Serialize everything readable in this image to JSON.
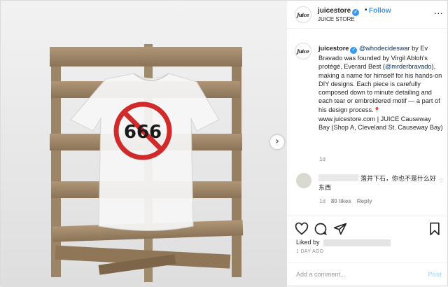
{
  "header": {
    "username": "juicestore",
    "dot": "•",
    "follow_label": "Follow",
    "subtitle": "JUICE STORE",
    "more_icon": "...",
    "logo_text": "Juice"
  },
  "photo": {
    "print_text": "666",
    "next_arrow": "›"
  },
  "caption": {
    "username": "juicestore",
    "mention1": "@whodecideswar",
    "text1": " by Ev Bravado was founded by Virgil Abloh's protégé, Everard Best (",
    "mention2": "@mrderbravado",
    "text2": "), making a name for himself for his hands-on DIY designs. Each piece is carefully composed down to minute detailing and each tear or embroidered motif — a part of his design process.",
    "pin": "📍",
    "text3": "www.juicestore.com | JUICE Causeway Bay (Shop A, Cleveland St. Causeway Bay)",
    "time": "1d"
  },
  "comment": {
    "text": "落井下石，你也不是什么好东西",
    "time": "1d",
    "likes": "80 likes",
    "reply": "Reply",
    "like_icon": "♡"
  },
  "actions": {
    "icons": [
      "heart-icon",
      "comment-icon",
      "share-icon",
      "bookmark-icon"
    ]
  },
  "likes_label": "Liked by",
  "post_time": "1 DAY AGO",
  "add_comment": {
    "placeholder": "Add a comment...",
    "post_label": "Post"
  }
}
